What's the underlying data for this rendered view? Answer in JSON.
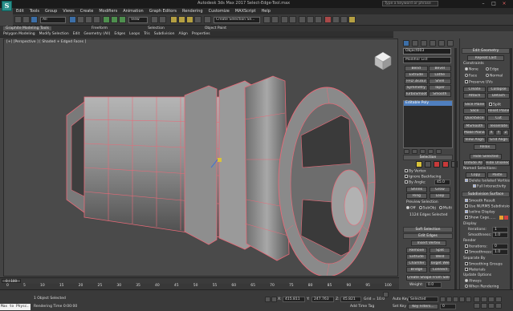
{
  "window": {
    "title": "Autodesk 3ds Max 2017   Select-Edge-Tool.max",
    "help_search": "Type a keyword or phrase"
  },
  "menu": [
    "Edit",
    "Tools",
    "Group",
    "Views",
    "Create",
    "Modifiers",
    "Animation",
    "Graph Editors",
    "Rendering",
    "Customize",
    "MAXScript",
    "Help"
  ],
  "toolbar": {
    "selection_filter": "All",
    "view_dropdown": "View",
    "selection_set": "Create Selection Se..."
  },
  "ribbon_tabs": [
    "Graphite Modeling Tools",
    "Freeform",
    "Selection",
    "Object Paint"
  ],
  "ribbon_active": "Graphite Modeling Tools",
  "ribbon_subtabs": [
    "Polygon Modeling",
    "Modify Selection",
    "Edit",
    "Geometry (All)",
    "Edges",
    "Loops",
    "Tris",
    "Subdivision",
    "Align",
    "Properties"
  ],
  "viewport": {
    "label": "[+] [Perspective ] [ Shaded + Edged Faces ]"
  },
  "command_panel": {
    "object_name": "Object003",
    "modifier_list": "Modifier List",
    "modifier_buttons": [
      [
        "Bend",
        "Bevel"
      ],
      [
        "Extrude",
        "Lathe"
      ],
      [
        "FFD 3x3x3",
        "Shell"
      ],
      [
        "Symmetry",
        "Taper"
      ],
      [
        "TurboSmooth",
        "Smooth"
      ]
    ],
    "stack_item": "Editable Poly",
    "selection_header": "Selection",
    "by_vertex": "By Vertex",
    "ignore_backfacing": "Ignore Backfacing",
    "by_angle": "By Angle:",
    "by_angle_value": "45.0",
    "shrink": "Shrink",
    "grow": "Grow",
    "ring": "Ring",
    "loop": "Loop",
    "preview_selection": "Preview Selection",
    "preview_options": [
      "Off",
      "SubObj",
      "Multi"
    ],
    "selected_status": "1124 Edges Selected",
    "soft_selection": "Soft Selection",
    "edit_edges": "Edit Edges",
    "insert_vertex": "Insert Vertex",
    "remove": "Remove",
    "split": "Split",
    "extrude": "Extrude",
    "weld": "Weld",
    "chamfer": "Chamfer",
    "target_weld": "Target Weld",
    "bridge": "Bridge",
    "connect": "Connect",
    "create_shape": "Create Shape From Selection",
    "weight_label": "Weight:",
    "weight_value": "0.0",
    "crease_label": "Crease:",
    "crease_value": "0.0"
  },
  "right_panel": {
    "edit_geometry": "Edit Geometry",
    "repeat_last": "Repeat Last",
    "constraints": "Constraints",
    "constraint_opts": [
      [
        "None",
        "Edge"
      ],
      [
        "Face",
        "Normal"
      ]
    ],
    "preserve_uvs": "Preserve UVs",
    "create": "Create",
    "collapse": "Collapse",
    "attach": "Attach",
    "detach": "Detach",
    "slice_plane": "Slice Plane",
    "split": "Split",
    "slice": "Slice",
    "reset_plane": "Reset Plane",
    "quickslice": "QuickSlice",
    "cut": "Cut",
    "msmooth": "MSmooth",
    "tessellate": "Tessellate",
    "make_planar": "Make Planar",
    "make_planar_axes": [
      "X",
      "Y",
      "Z"
    ],
    "view_align": "View Align",
    "grid_align": "Grid Align",
    "relax": "Relax",
    "hide_selected": "Hide Selected",
    "unhide_all": "Unhide All",
    "hide_unselected": "Hide Unselected",
    "named_selections": "Named Selections:",
    "copy": "Copy",
    "paste": "Paste",
    "delete_isolated": "Delete Isolated Vertices",
    "full_interactivity": "Full Interactivity",
    "subdivision_surface": "Subdivision Surface",
    "smooth_result": "Smooth Result",
    "use_nurms": "Use NURMS Subdivision",
    "isoline_display": "Isoline Display",
    "show_cage": "Show Cage......",
    "display": "Display",
    "iterations_label": "Iterations:",
    "iterations_value": "1",
    "smoothness_label": "Smoothness:",
    "smoothness_value": "1.0",
    "render": "Render",
    "r_iterations_value": "0",
    "r_smoothness_value": "1.0",
    "separate_by": "Separate By",
    "smoothing_groups": "Smoothing Groups",
    "materials": "Materials",
    "update_options": "Update Options",
    "update_opts": [
      "Always",
      "When Rendering",
      "Manually"
    ]
  },
  "timeline": {
    "range": "0 / 100",
    "ticks": [
      "0",
      "5",
      "10",
      "15",
      "20",
      "25",
      "30",
      "35",
      "40",
      "45",
      "50",
      "55",
      "60",
      "65",
      "70",
      "75",
      "80",
      "85",
      "90",
      "95",
      "100"
    ]
  },
  "status": {
    "maxscript": "Max to Physc.",
    "selected": "1 Object Selected",
    "prompt": "Rendering Time  0:00:00",
    "x_label": "X:",
    "x_value": "415.811",
    "y_label": "Y:",
    "y_value": "247.763",
    "z_label": "Z:",
    "z_value": "45.821",
    "grid": "Grid = 10.0",
    "add_time_tag": "Add Time Tag",
    "auto_key": "Auto Key",
    "auto_key_mode": "Selected",
    "set_key": "Set Key",
    "key_filters": "Key Filters...",
    "frame": "0"
  },
  "colors": {
    "accent": "#3c6fa8",
    "selection_wire": "#e86a78",
    "mesh": "#9a9a9a"
  }
}
